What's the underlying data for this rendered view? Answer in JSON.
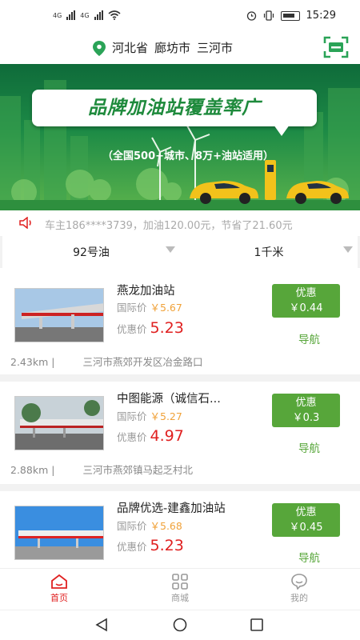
{
  "status_bar": {
    "net_a": "4G",
    "net_b": "4G",
    "time": "15:29"
  },
  "location": {
    "province": "河北省",
    "city": "廊坊市",
    "district": "三河市"
  },
  "banner": {
    "title": "品牌加油站覆盖率广",
    "subtitle": "（全国500+城市、8万+油站适用）"
  },
  "ticker": {
    "text": "车主186****3739，加油120.00元，节省了21.60元"
  },
  "filters": [
    {
      "label": "92号油"
    },
    {
      "label": "1千米"
    }
  ],
  "stations": [
    {
      "name": "燕龙加油站",
      "intl_label": "国际价",
      "intl_price": "￥5.67",
      "disc_label": "优惠价",
      "disc_price": "5.23",
      "deal_label": "优惠",
      "deal_value": "￥0.44",
      "nav_label": "导航",
      "distance": "2.43km |",
      "address": "三河市燕郊开发区冶金路口"
    },
    {
      "name": "中图能源（诚信石...",
      "intl_label": "国际价",
      "intl_price": "￥5.27",
      "disc_label": "优惠价",
      "disc_price": "4.97",
      "deal_label": "优惠",
      "deal_value": "￥0.3",
      "nav_label": "导航",
      "distance": "2.88km |",
      "address": "三河市燕郊镇马起乏村北"
    },
    {
      "name": "品牌优选-建鑫加油站",
      "intl_label": "国际价",
      "intl_price": "￥5.68",
      "disc_label": "优惠价",
      "disc_price": "5.23",
      "deal_label": "优惠",
      "deal_value": "￥0.45",
      "nav_label": "导航",
      "distance": "",
      "address": ""
    }
  ],
  "tabs": [
    {
      "label": "首页",
      "icon": "home-icon"
    },
    {
      "label": "商城",
      "icon": "grid-icon"
    },
    {
      "label": "我的",
      "icon": "chat-icon"
    }
  ],
  "colors": {
    "accent_green": "#57a63a",
    "price_red": "#e02020",
    "orange": "#f0a23a",
    "banner_green": "#1c8a46"
  }
}
